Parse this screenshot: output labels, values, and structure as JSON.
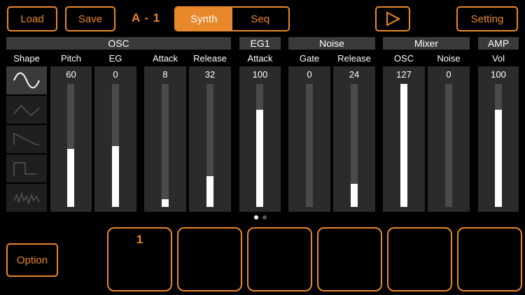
{
  "toolbar": {
    "load_label": "Load",
    "save_label": "Save",
    "patch_name": "A - 1",
    "tab_synth": "Synth",
    "tab_seq": "Seq",
    "setting_label": "Setting",
    "play_icon": "play-icon"
  },
  "sections": {
    "osc": "OSC",
    "eg1": "EG1",
    "noise": "Noise",
    "mixer": "Mixer",
    "amp": "AMP"
  },
  "columns": {
    "shape": "Shape",
    "pitch": {
      "label": "Pitch",
      "value": "60",
      "level": 60
    },
    "eg": {
      "label": "EG",
      "value": "0",
      "level": 63
    },
    "osc_attack": {
      "label": "Attack",
      "value": "8",
      "level": 8
    },
    "osc_release": {
      "label": "Release",
      "value": "32",
      "level": 32
    },
    "eg1_attack": {
      "label": "Attack",
      "value": "100",
      "level": 100
    },
    "noise_gate": {
      "label": "Gate",
      "value": "0",
      "level": 0
    },
    "noise_release": {
      "label": "Release",
      "value": "24",
      "level": 24
    },
    "mixer_osc": {
      "label": "OSC",
      "value": "127",
      "level": 127
    },
    "mixer_noise": {
      "label": "Noise",
      "value": "0",
      "level": 0
    },
    "amp_vol": {
      "label": "Vol",
      "value": "100",
      "level": 100
    }
  },
  "shapes": [
    "sine-wave-icon",
    "triangle-wave-icon",
    "sawtooth-wave-icon",
    "square-wave-icon",
    "noise-wave-icon"
  ],
  "page_dots": {
    "count": 2,
    "active": 0
  },
  "option_label": "Option",
  "pads": [
    "1",
    "",
    "",
    "",
    "",
    ""
  ],
  "colors": {
    "accent": "#e8882a",
    "panel": "#2b2b2b",
    "header": "#3a3a3a"
  }
}
